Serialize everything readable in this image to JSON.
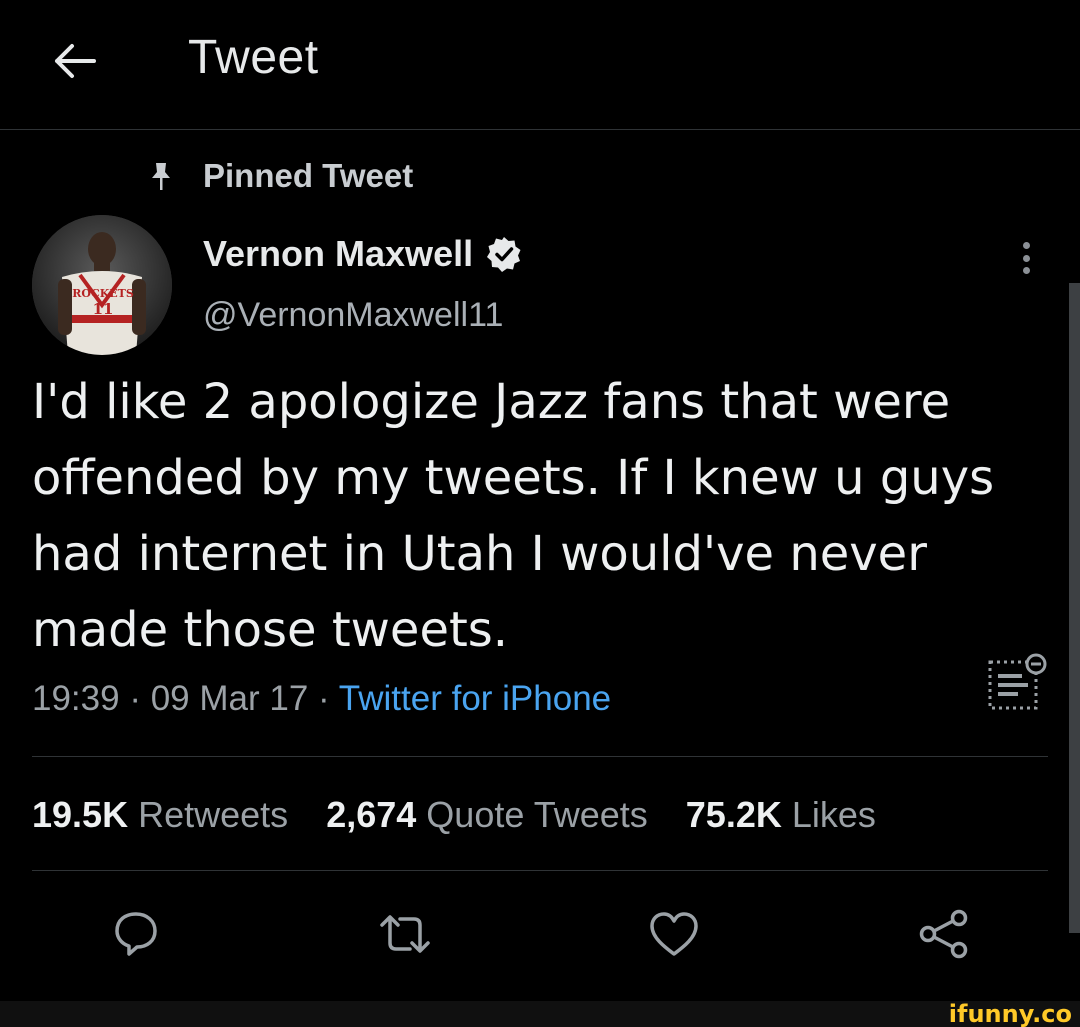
{
  "header": {
    "title": "Tweet",
    "back_icon": "arrow-left-icon"
  },
  "pinned": {
    "label": "Pinned Tweet",
    "icon": "pin-icon"
  },
  "author": {
    "name": "Vernon Maxwell",
    "handle": "@VernonMaxwell11",
    "verified": true,
    "avatar_jersey_text": "ROCKETS",
    "avatar_jersey_number": "11"
  },
  "tweet": {
    "text": "I'd like 2 apologize Jazz fans that were offended by my tweets. If I knew u guys had internet in Utah I would've never made those tweets.",
    "time": "19:39",
    "date": "09 Mar 17",
    "separator": "·",
    "source": "Twitter for iPhone"
  },
  "stats": {
    "retweets_count": "19.5K",
    "retweets_label": "Retweets",
    "quotes_count": "2,674",
    "quotes_label": "Quote Tweets",
    "likes_count": "75.2K",
    "likes_label": "Likes"
  },
  "actions": [
    "reply-icon",
    "retweet-icon",
    "like-icon",
    "share-icon"
  ],
  "watermark": "ifunny.co",
  "colors": {
    "background": "#000000",
    "text": "#e7e9ea",
    "secondary_text": "#9ba1a6",
    "link": "#4aa4f0",
    "divider": "#2f3336",
    "watermark": "#ffc928"
  }
}
